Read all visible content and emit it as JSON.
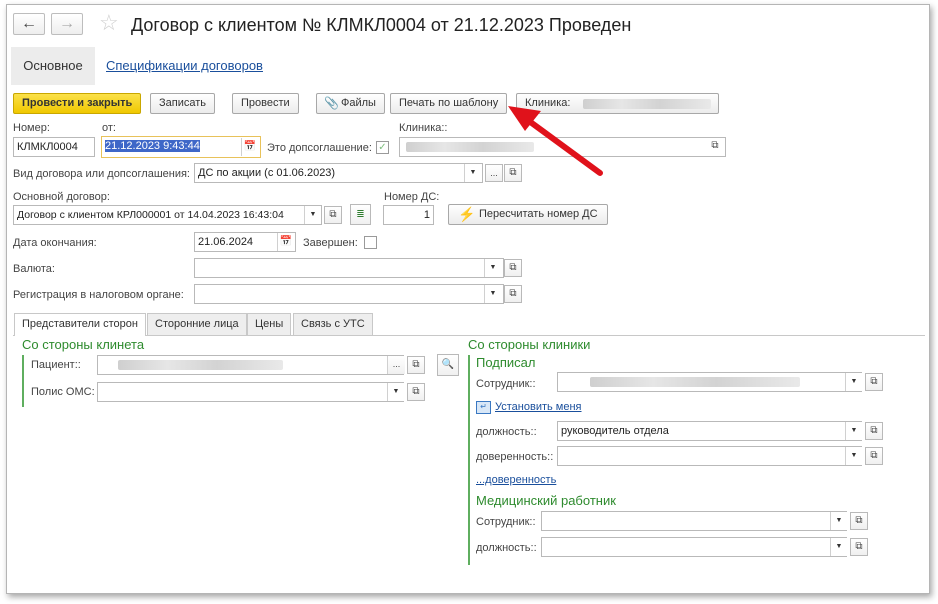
{
  "window": {
    "title": "Договор с клиентом № КЛМКЛ0004 от 21.12.2023 Проведен",
    "back_icon": "arrow-left-icon",
    "forward_icon": "arrow-right-icon",
    "favorite_icon": "star-icon"
  },
  "tabs": [
    {
      "label": "Основное",
      "active": true
    },
    {
      "label": "Спецификации договоров",
      "active": false
    }
  ],
  "toolbar": {
    "post_close": "Провести и закрыть",
    "save": "Записать",
    "post": "Провести",
    "files": "Файлы",
    "print_template": "Печать по шаблону",
    "clinic_prefix": "Клиника:"
  },
  "form": {
    "number_label": "Номер:",
    "number_value": "КЛМКЛ0004",
    "date_label": "от:",
    "date_value": "21.12.2023  9:43:44",
    "addendum_label": "Это допсоглашение:",
    "addendum_checked": true,
    "clinic_label": "Клиника::",
    "contract_type_label": "Вид договора или допсоглашения:",
    "contract_type_value": "ДС по акции (с 01.06.2023)",
    "main_contract_label": "Основной договор:",
    "main_contract_value": "Договор с клиентом КРЛ000001 от 14.04.2023 16:43:04",
    "ds_number_label": "Номер ДС:",
    "ds_number_value": "1",
    "recalc_button": "Пересчитать номер ДС",
    "end_date_label": "Дата окончания:",
    "end_date_value": "21.06.2024",
    "completed_label": "Завершен:",
    "completed_checked": false,
    "currency_label": "Валюта:",
    "currency_value": "",
    "tax_label": "Регистрация в налоговом органе:",
    "tax_value": ""
  },
  "subtabs": [
    {
      "label": "Представители сторон",
      "active": true
    },
    {
      "label": "Сторонние лица",
      "active": false
    },
    {
      "label": "Цены",
      "active": false
    },
    {
      "label": "Связь с УТС",
      "active": false
    }
  ],
  "client_side": {
    "title": "Со стороны клинета",
    "patient_label": "Пациент::",
    "patient_value": "",
    "oms_label": "Полис ОМС:",
    "oms_value": ""
  },
  "clinic_side": {
    "title": "Со стороны клиники",
    "signed_title": "Подписал",
    "employee_label": "Сотрудник::",
    "employee_value": "",
    "set_me_link": "Установить меня",
    "position_label": "должность::",
    "position_value": "руководитель отдела",
    "proxy_label": "доверенность::",
    "proxy_value": "",
    "proxy_link": "...доверенность",
    "medical_title": "Медицинский работник",
    "med_employee_label": "Сотрудник::",
    "med_employee_value": "",
    "med_position_label": "должность::",
    "med_position_value": ""
  },
  "colors": {
    "accent_yellow": "#f0c800",
    "section_green": "#2e8b2e",
    "link_blue": "#1a4f9c",
    "arrow_red": "#e0121b"
  }
}
